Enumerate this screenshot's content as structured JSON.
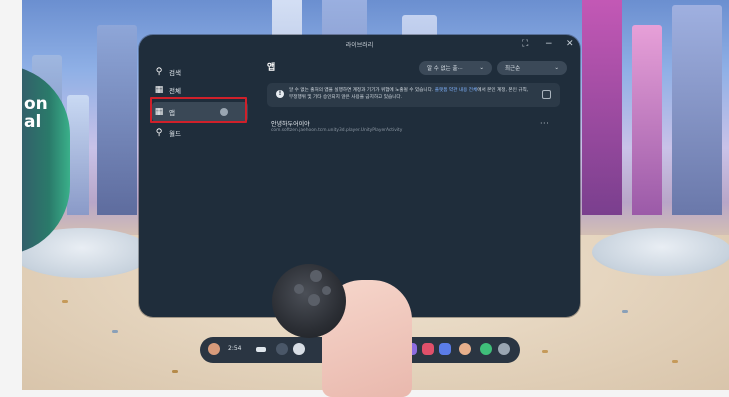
{
  "scene": {
    "portal_text": "on\nal"
  },
  "window": {
    "title": "라이브러리",
    "controls": {
      "resize": "⛶",
      "minimize": "−",
      "close": "✕"
    }
  },
  "sidebar": {
    "items": [
      {
        "label": "검색",
        "icon": "search-icon",
        "glyph": "🔍"
      },
      {
        "label": "전체",
        "icon": "grid-icon",
        "glyph": "▦"
      },
      {
        "label": "앱",
        "icon": "apps-icon",
        "glyph": "▦",
        "active": true
      },
      {
        "label": "월드",
        "icon": "world-pin-icon",
        "glyph": "⚲"
      }
    ]
  },
  "content": {
    "title": "앱",
    "filter_label": "알 수 없는 출···",
    "sort_label": "최근순",
    "notice_text": "알 수 없는 출처의 앱을 실행하면 계정과 기기가 위험에 노출될 수 있습니다.",
    "notice_link": "플랫폼 약관 내용 전체",
    "notice_tail": "에서 본인 계정, 본인 규칙, 부정행위 및 기타 승인되지 않은 사용을 금지하고 있습니다.",
    "app": {
      "name": "안녕하두어이야",
      "package": "com.softzen.jaehoon.tcm.unity3d.player.UnityPlayerActivity",
      "more": "···"
    }
  },
  "taskbar": {
    "time": "2:54",
    "battery_icon": "battery-icon"
  },
  "colors": {
    "panel_bg": "#1f2d3b",
    "highlight": "#d0202a",
    "link": "#7fb2ff"
  }
}
